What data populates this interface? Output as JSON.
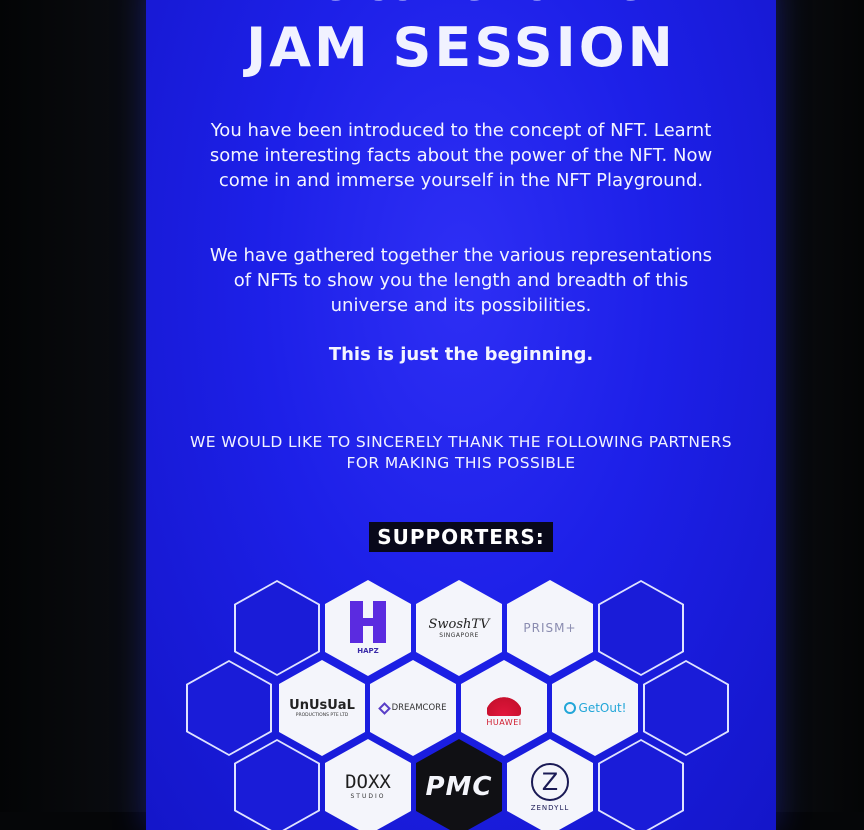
{
  "poster": {
    "welcome": "Welcome to the",
    "title": "JAM SESSION",
    "paragraph_1": "You have been introduced to the concept of NFT. Learnt some interesting facts about the power of the NFT. Now come in and immerse yourself in the NFT Playground.",
    "paragraph_2": "We have gathered together the various representations of NFTs to show you the length and breadth of this universe and its possibilities.",
    "paragraph_3": "This is just the beginning.",
    "thanks": "WE WOULD LIKE TO SINCERELY THANK THE FOLLOWING PARTNERS FOR MAKING THIS POSSIBLE",
    "supporters_heading": "SUPPORTERS:"
  },
  "sponsors": {
    "hapz": "HAPZ",
    "swoshtv": "SwoshTV",
    "swoshtv_sub": "SINGAPORE",
    "prism": "PRISM+",
    "unusual": "UnUsUaL",
    "unusual_sub": "PRODUCTIONS PTE LTD",
    "dreamcore": "DREAMCORE",
    "huawei": "HUAWEI",
    "getout": "GetOut!",
    "doxx": "DOXX",
    "doxx_sub": "STUDIO",
    "pmc": "PMC",
    "zendyll": "ZENDYLL"
  },
  "colors": {
    "poster_blue": "#1d20e8",
    "background": "#050608"
  }
}
